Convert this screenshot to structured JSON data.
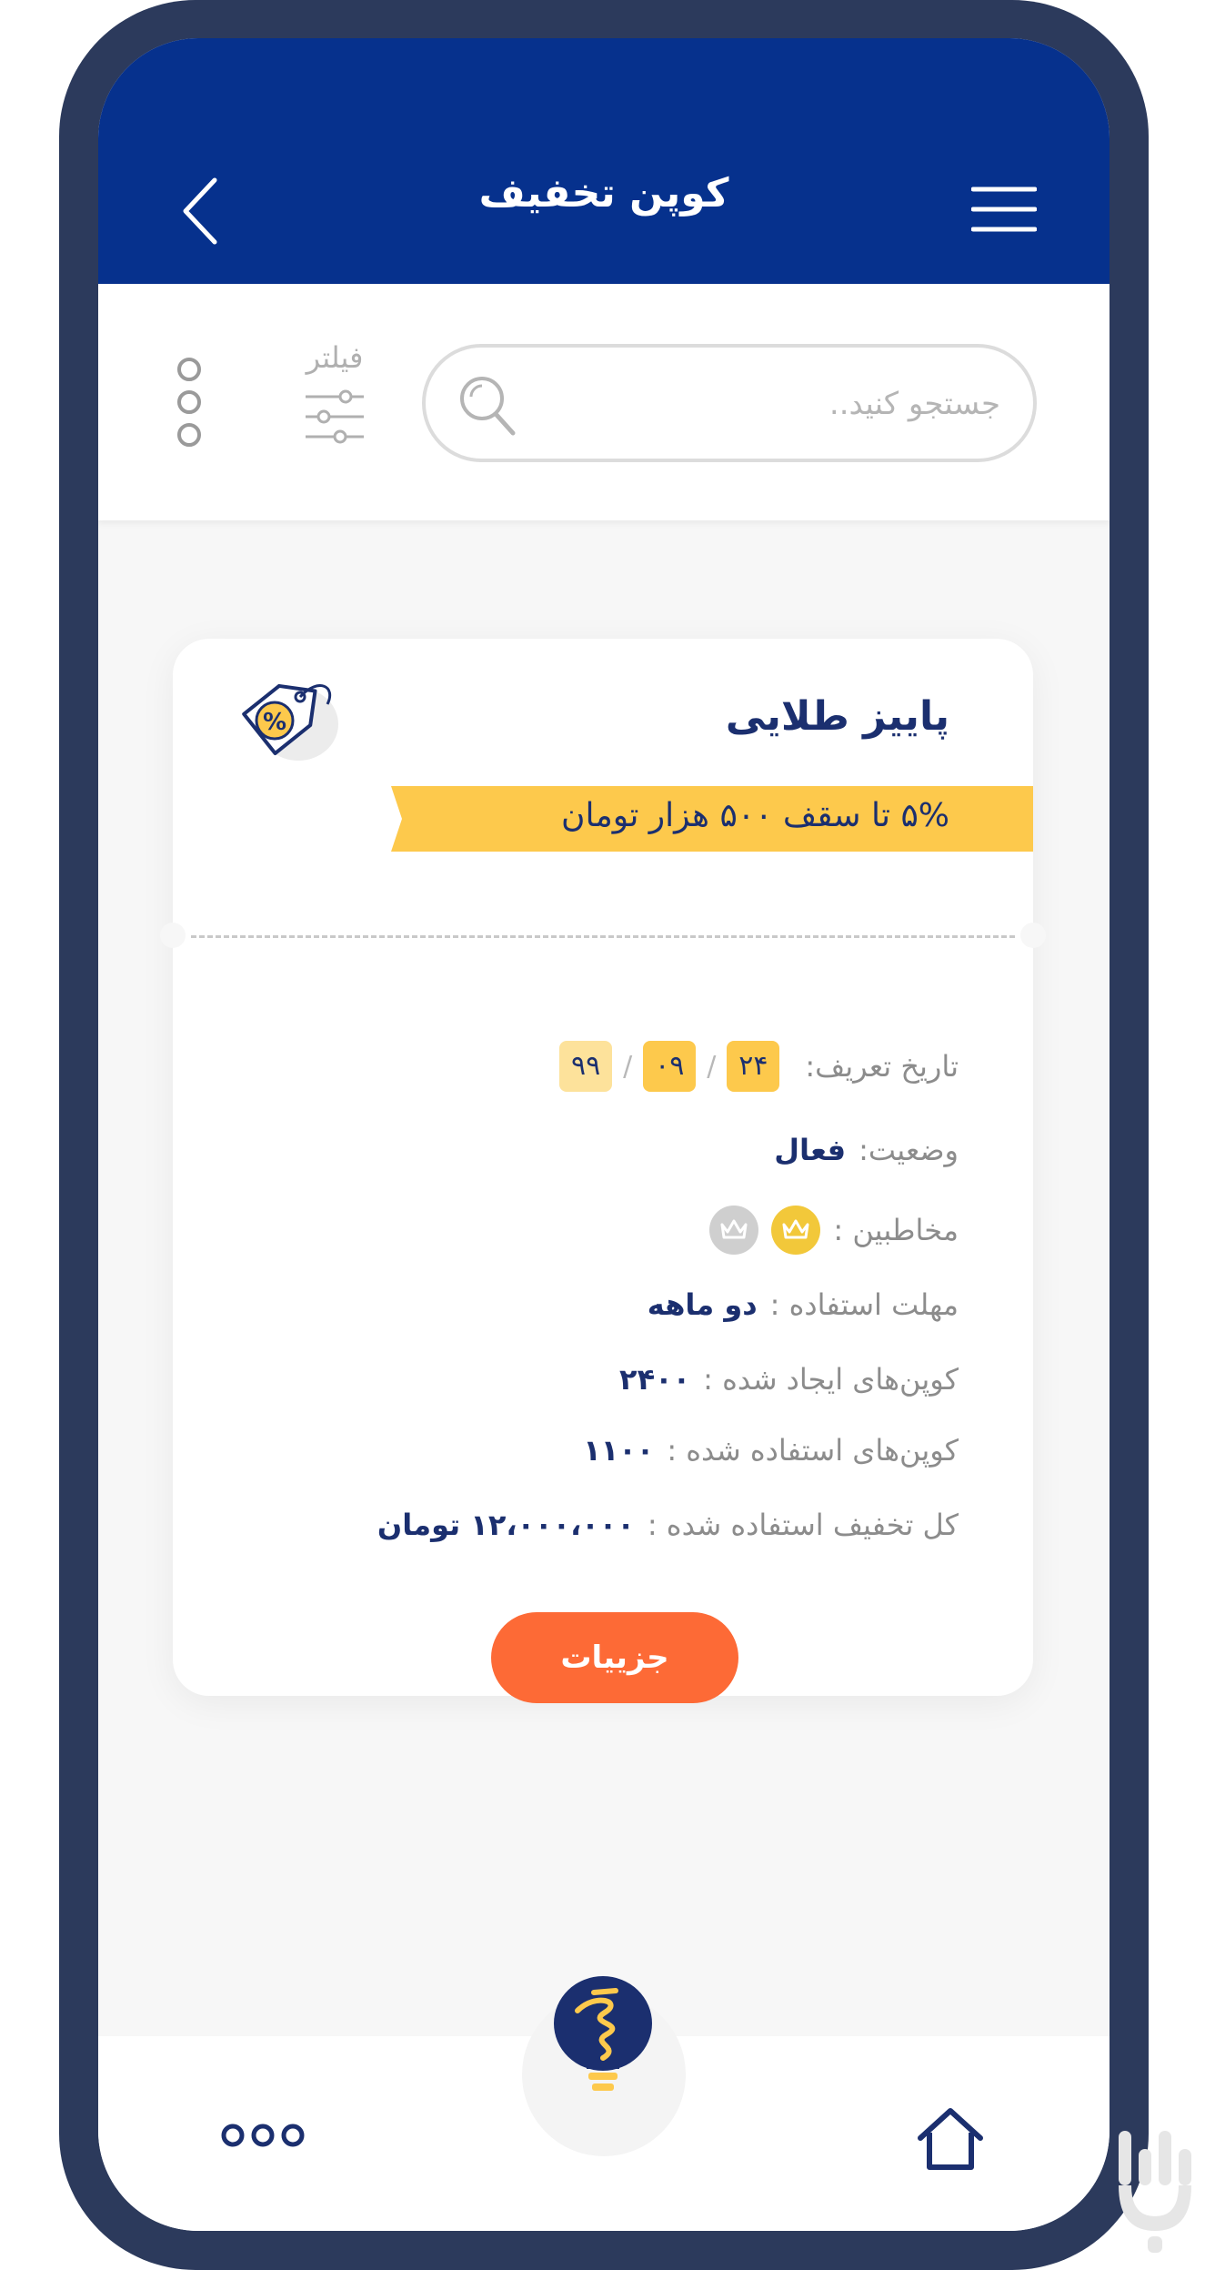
{
  "header": {
    "title": "کوپن تخفیف"
  },
  "search": {
    "placeholder": "جستجو کنید.."
  },
  "toolbar": {
    "filter_label": "فیلتر"
  },
  "card": {
    "title": "پاییز طلایی",
    "ribbon": "۵% تا سقف ۵۰۰ هزار تومان",
    "rows": [
      {
        "label": "تاریخ تعریف:",
        "date": [
          "۲۴",
          "۰۹",
          "۹۹"
        ]
      },
      {
        "label": "وضعیت:",
        "value": "فعال"
      },
      {
        "label": "مخاطبین :"
      },
      {
        "label": "مهلت استفاده :",
        "value": "دو ماهه"
      },
      {
        "label": "کوپن‌های ایجاد شده :",
        "value": "۲۴۰۰"
      },
      {
        "label": "کوپن‌های استفاده شده :",
        "value": "۱۱۰۰"
      },
      {
        "label": "کل تخفیف استفاده شده :",
        "value": "۱۲،۰۰۰،۰۰۰ تومان"
      }
    ],
    "details_button": "جزییات"
  },
  "colors": {
    "primary": "#06318d",
    "accent": "#fd6a36",
    "highlight": "#fdc94c",
    "text": "#1b2f6f"
  },
  "icons": [
    "back-arrow-icon",
    "hamburger-menu-icon",
    "search-icon",
    "filter-sliders-icon",
    "more-vertical-icon",
    "discount-tag-icon",
    "crown-icon",
    "lightbulb-icon",
    "home-icon",
    "more-horizontal-icon"
  ]
}
